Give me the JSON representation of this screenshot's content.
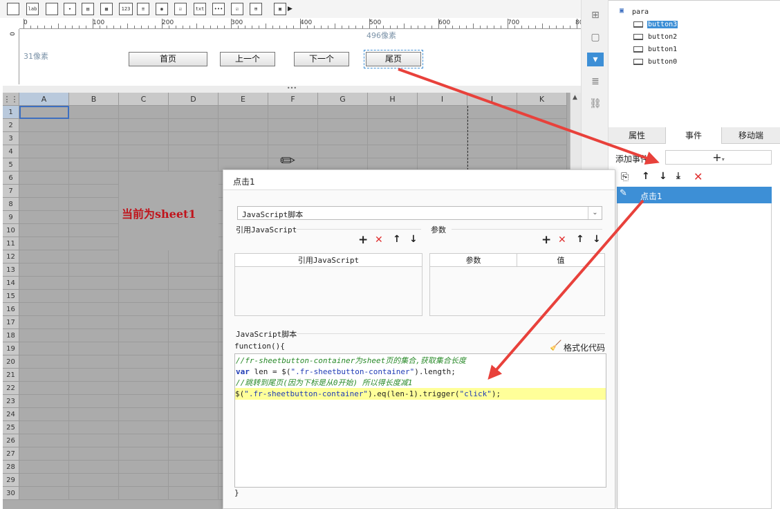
{
  "canvas": {
    "ruler_labels": [
      "0",
      "100",
      "200",
      "300",
      "400",
      "500",
      "600",
      "700",
      "80"
    ],
    "left_ruler_label": "0",
    "px_left": "31像素",
    "px_top": "496像素",
    "buttons": [
      "首页",
      "上一个",
      "下一个",
      "尾页"
    ]
  },
  "sheet": {
    "columns": [
      "A",
      "B",
      "C",
      "D",
      "E",
      "F",
      "G",
      "H",
      "I",
      "J",
      "K"
    ],
    "rows": [
      "1",
      "2",
      "3",
      "4",
      "5",
      "6",
      "7",
      "8",
      "9",
      "10",
      "11",
      "12",
      "13",
      "14",
      "15",
      "16",
      "17",
      "18",
      "19",
      "20",
      "21",
      "22",
      "23",
      "24",
      "25",
      "26",
      "27",
      "28",
      "29",
      "30"
    ],
    "merged_text": "当前为sheet1"
  },
  "tree": {
    "root": "para",
    "items": [
      "button3",
      "button2",
      "button1",
      "button0"
    ],
    "selected": "button3"
  },
  "tabs": [
    "属性",
    "事件",
    "移动端"
  ],
  "event_panel": {
    "add_event_label": "添加事件",
    "event_item": "点击1"
  },
  "dialog": {
    "title": "点击1",
    "type_value": "JavaScript脚本",
    "ref_js_label": "引用JavaScript",
    "params_label": "参数",
    "ref_js_col": "引用JavaScript",
    "param_col": "参数",
    "value_col": "值",
    "script_label": "JavaScript脚本",
    "function_open": "function(){",
    "format_label": "格式化代码",
    "code_lines": [
      "//fr-sheetbutton-container为sheet页的集合,获取集合长度",
      "var len = $(\".fr-sheetbutton-container\").length;",
      "//跳转到尾页(因为下标是从0开始) 所以得长度减1",
      "$(\".fr-sheetbutton-container\").eq(len-1).trigger(\"click\");"
    ],
    "function_close": "}"
  },
  "colors": {
    "accent": "#3d8fd6",
    "arrow": "#e8413b",
    "merged_text": "#c0141c",
    "highlight": "#ffff99"
  }
}
